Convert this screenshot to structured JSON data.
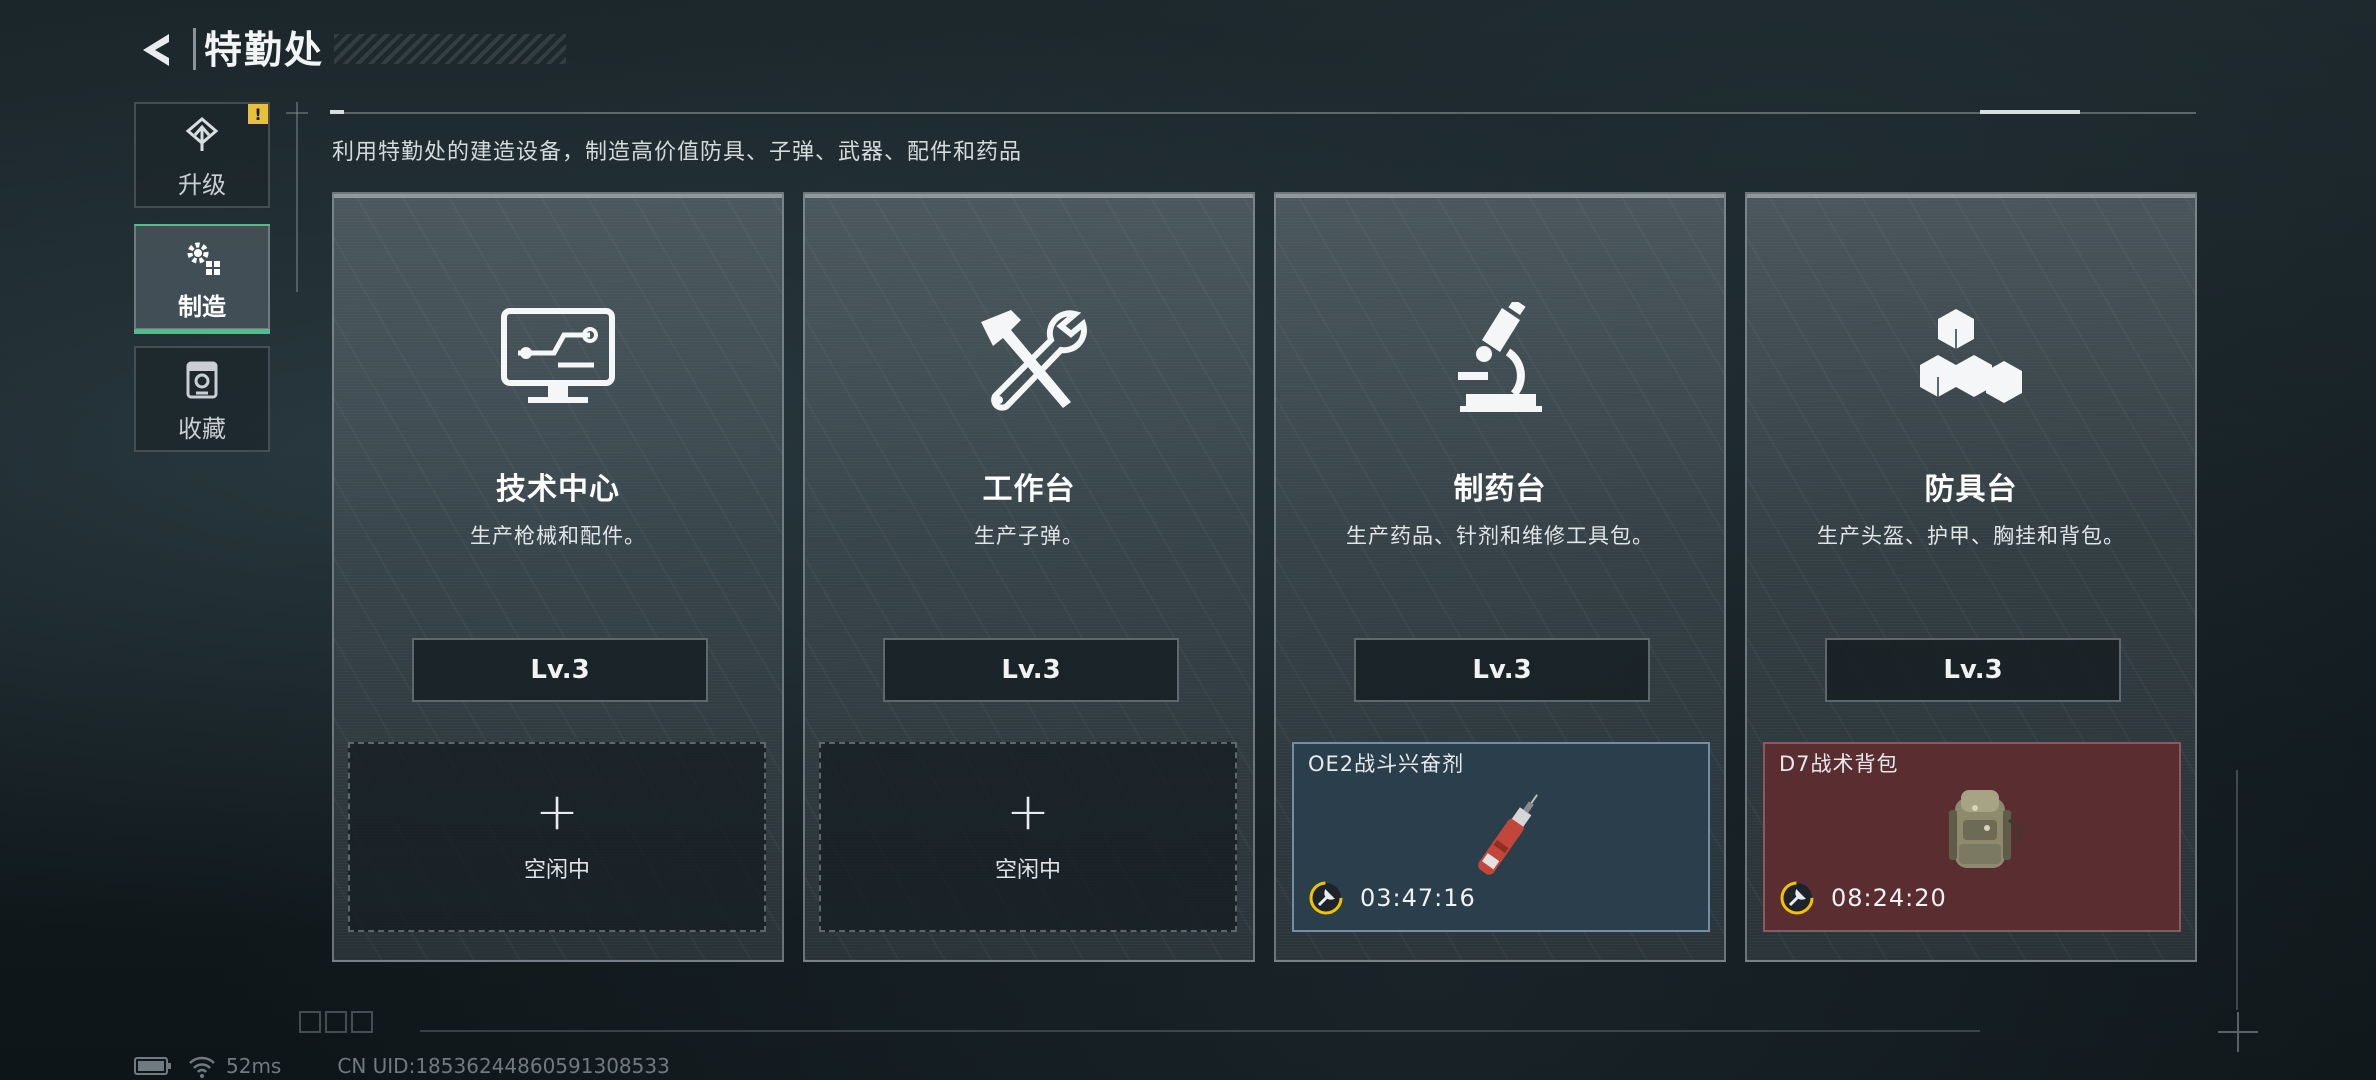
{
  "header": {
    "back_icon": "back-arrow-icon",
    "title": "特勤处"
  },
  "side_nav": [
    {
      "id": "upgrade",
      "label": "升级",
      "icon": "upgrade-arrow-icon",
      "badge": "!",
      "active": false
    },
    {
      "id": "craft",
      "label": "制造",
      "icon": "gear-craft-icon",
      "active": true
    },
    {
      "id": "collection",
      "label": "收藏",
      "icon": "trophy-box-icon",
      "active": false
    }
  ],
  "description": "利用特勤处的建造设备，制造高价值防具、子弹、武器、配件和药品",
  "stations": [
    {
      "title": "技术中心",
      "subtitle": "生产枪械和配件。",
      "icon": "monitor-circuit-icon",
      "level": "Lv.3",
      "slot": {
        "status": "idle",
        "label": "空闲中",
        "plus": "+"
      }
    },
    {
      "title": "工作台",
      "subtitle": "生产子弹。",
      "icon": "hammer-wrench-icon",
      "level": "Lv.3",
      "slot": {
        "status": "idle",
        "label": "空闲中",
        "plus": "+"
      }
    },
    {
      "title": "制药台",
      "subtitle": "生产药品、针剂和维修工具包。",
      "icon": "microscope-icon",
      "level": "Lv.3",
      "slot": {
        "status": "busy",
        "item_name": "OE2战斗兴奋剂",
        "item_icon": "injector-icon",
        "timer": "03:47:16",
        "color": "#2a3e4c"
      }
    },
    {
      "title": "防具台",
      "subtitle": "生产头盔、护甲、胸挂和背包。",
      "icon": "cubes-icon",
      "level": "Lv.3",
      "slot": {
        "status": "busy",
        "item_name": "D7战术背包",
        "item_icon": "backpack-icon",
        "timer": "08:24:20",
        "color": "#5a2d31"
      }
    }
  ],
  "status_bar": {
    "latency": "52ms",
    "uid": "CN UID:185362448605913​08533"
  },
  "colors": {
    "accent_green": "#4cc08a",
    "warning_yellow": "#e8c13a",
    "timer_yellow": "#f2c200"
  }
}
